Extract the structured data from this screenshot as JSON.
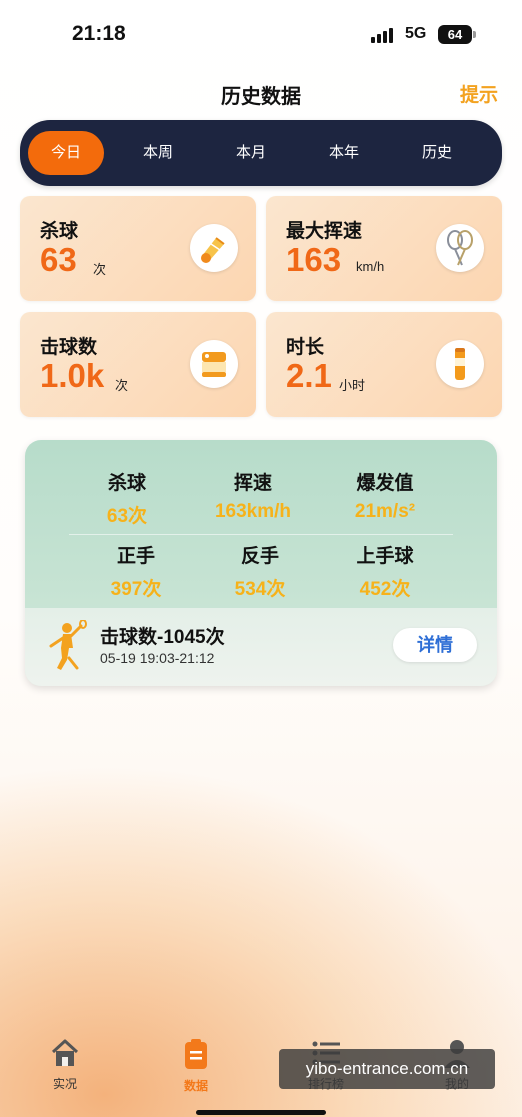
{
  "status": {
    "time": "21:18",
    "network": "5G",
    "battery": "64"
  },
  "header": {
    "title": "历史数据",
    "hint": "提示"
  },
  "tabs": [
    "今日",
    "本周",
    "本月",
    "本年",
    "历史"
  ],
  "cards": {
    "smash": {
      "label": "杀球",
      "value": "63",
      "unit": "次",
      "icon": "shuttlecock-icon"
    },
    "max_speed": {
      "label": "最大挥速",
      "value": "163",
      "unit": "km/h",
      "icon": "rackets-icon"
    },
    "hits": {
      "label": "击球数",
      "value": "1.0k",
      "unit": "次",
      "icon": "shuttle-tube-icon"
    },
    "duration": {
      "label": "时长",
      "value": "2.1",
      "unit": "小时",
      "icon": "timer-tube-icon"
    }
  },
  "summary": {
    "stats": [
      {
        "label": "杀球",
        "value": "63次"
      },
      {
        "label": "挥速",
        "value": "163km/h"
      },
      {
        "label": "爆发值",
        "value": "21m/s²"
      },
      {
        "label": "正手",
        "value": "397次"
      },
      {
        "label": "反手",
        "value": "534次"
      },
      {
        "label": "上手球",
        "value": "452次"
      }
    ],
    "session_title": "击球数-1045次",
    "session_time": "05-19 19:03-21:12",
    "detail_label": "详情"
  },
  "bottom_nav": [
    {
      "label": "实况",
      "icon": "home-icon"
    },
    {
      "label": "数据",
      "icon": "clipboard-icon"
    },
    {
      "label": "排行榜",
      "icon": "ranking-list-icon"
    },
    {
      "label": "我的",
      "icon": "user-icon"
    }
  ],
  "watermark": "yibo-entrance.com.cn",
  "colors": {
    "accent": "#f06817",
    "tab_bg": "#1d2540",
    "stat_value": "#f6b21a",
    "link": "#2f6fd6"
  }
}
